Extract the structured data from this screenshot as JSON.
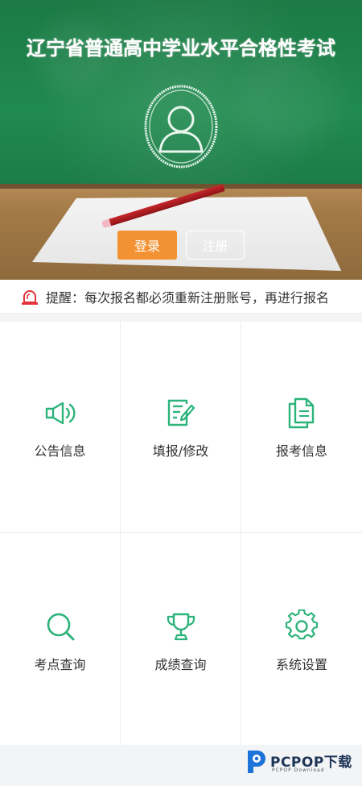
{
  "hero": {
    "title": "辽宁省普通高中学业水平合格性考试",
    "login_label": "登录",
    "register_label": "注册"
  },
  "notice": {
    "icon": "alarm-light-icon",
    "text": "提醒：每次报名都必须重新注册账号，再进行报名"
  },
  "menu": [
    {
      "label": "公告信息",
      "icon": "megaphone-icon"
    },
    {
      "label": "填报/修改",
      "icon": "edit-form-icon"
    },
    {
      "label": "报考信息",
      "icon": "documents-icon"
    },
    {
      "label": "考点查询",
      "icon": "search-icon"
    },
    {
      "label": "成绩查询",
      "icon": "trophy-icon"
    },
    {
      "label": "系统设置",
      "icon": "gear-icon"
    }
  ],
  "watermark": {
    "brand": "PCPOP下载",
    "sub": "PCPOP Download"
  },
  "colors": {
    "accent_green": "#2bb37a",
    "login_orange": "#f39233",
    "notice_red": "#e2343b"
  }
}
